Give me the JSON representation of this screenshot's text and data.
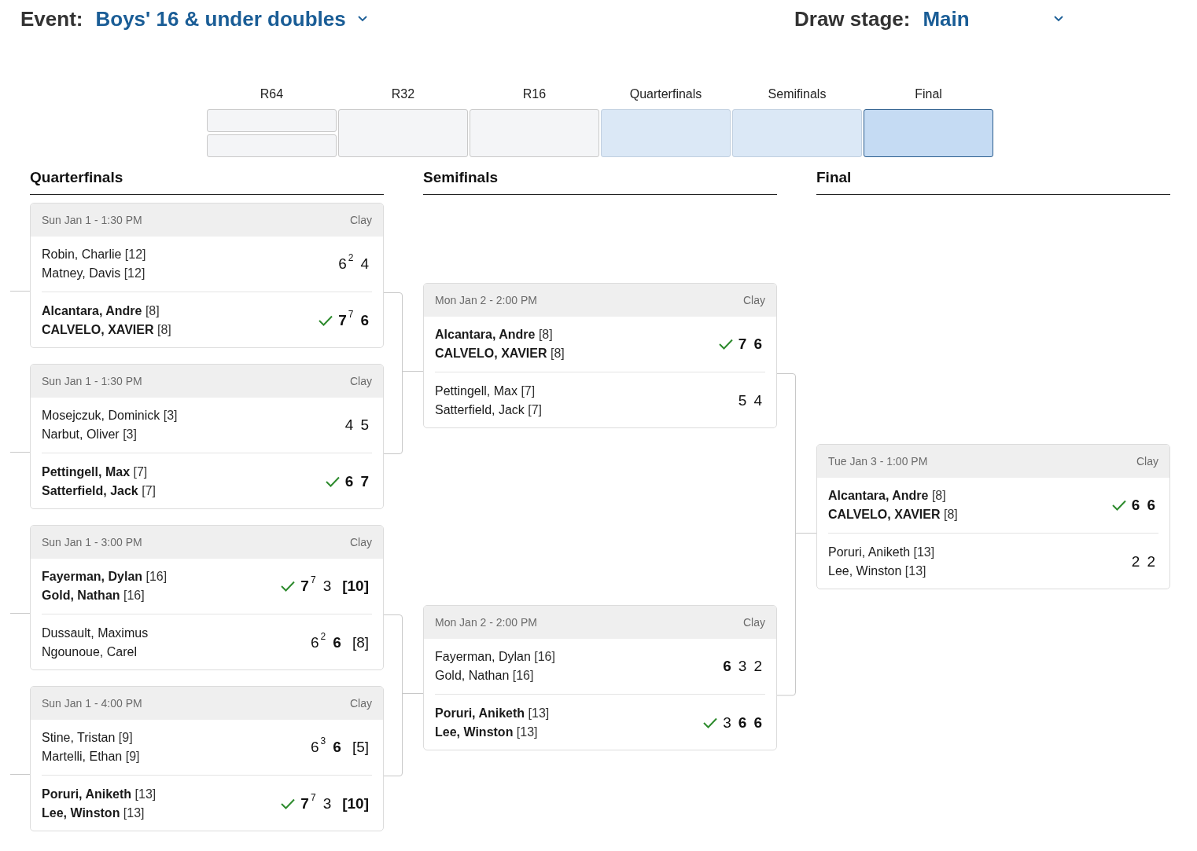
{
  "header": {
    "event": {
      "label": "Event:",
      "value": "Boys' 16 & under doubles"
    },
    "draw_stage": {
      "label": "Draw stage:",
      "value": "Main"
    }
  },
  "round_nav": [
    {
      "label": "R64",
      "kind": "split",
      "in_view": false,
      "selected": false
    },
    {
      "label": "R32",
      "kind": "single",
      "in_view": false,
      "selected": false
    },
    {
      "label": "R16",
      "kind": "single",
      "in_view": false,
      "selected": false
    },
    {
      "label": "Quarterfinals",
      "kind": "single",
      "in_view": true,
      "selected": false
    },
    {
      "label": "Semifinals",
      "kind": "single",
      "in_view": true,
      "selected": false
    },
    {
      "label": "Final",
      "kind": "single",
      "in_view": true,
      "selected": true
    }
  ],
  "columns": [
    {
      "title": "Quarterfinals",
      "matches": [
        {
          "date": "Sun Jan 1 - 1:30 PM",
          "surface": "Clay",
          "teams": [
            {
              "winner": false,
              "players": [
                {
                  "name": "Robin, Charlie",
                  "seed": "[12]"
                },
                {
                  "name": "Matney, Davis",
                  "seed": "[12]"
                }
              ],
              "scores": [
                {
                  "games": "6",
                  "tiebreak": "2",
                  "won": false
                },
                {
                  "games": "4",
                  "won": false
                }
              ]
            },
            {
              "winner": true,
              "players": [
                {
                  "name": "Alcantara, Andre",
                  "seed": "[8]"
                },
                {
                  "name": "CALVELO, XAVIER",
                  "seed": "[8]"
                }
              ],
              "scores": [
                {
                  "games": "7",
                  "tiebreak": "7",
                  "won": true
                },
                {
                  "games": "6",
                  "won": true
                }
              ]
            }
          ]
        },
        {
          "date": "Sun Jan 1 - 1:30 PM",
          "surface": "Clay",
          "teams": [
            {
              "winner": false,
              "players": [
                {
                  "name": "Mosejczuk, Dominick",
                  "seed": "[3]"
                },
                {
                  "name": "Narbut, Oliver",
                  "seed": "[3]"
                }
              ],
              "scores": [
                {
                  "games": "4",
                  "won": false
                },
                {
                  "games": "5",
                  "won": false
                }
              ]
            },
            {
              "winner": true,
              "players": [
                {
                  "name": "Pettingell, Max",
                  "seed": "[7]"
                },
                {
                  "name": "Satterfield, Jack",
                  "seed": "[7]"
                }
              ],
              "scores": [
                {
                  "games": "6",
                  "won": true
                },
                {
                  "games": "7",
                  "won": true
                }
              ]
            }
          ]
        },
        {
          "date": "Sun Jan 1 - 3:00 PM",
          "surface": "Clay",
          "teams": [
            {
              "winner": true,
              "players": [
                {
                  "name": "Fayerman, Dylan",
                  "seed": "[16]"
                },
                {
                  "name": "Gold, Nathan",
                  "seed": "[16]"
                }
              ],
              "scores": [
                {
                  "games": "7",
                  "tiebreak": "7",
                  "won": true
                },
                {
                  "games": "3",
                  "won": false
                },
                {
                  "games": "[10]",
                  "won": true
                }
              ]
            },
            {
              "winner": false,
              "players": [
                {
                  "name": "Dussault, Maximus"
                },
                {
                  "name": "Ngounoue, Carel"
                }
              ],
              "scores": [
                {
                  "games": "6",
                  "tiebreak": "2",
                  "won": false
                },
                {
                  "games": "6",
                  "won": true
                },
                {
                  "games": "[8]",
                  "won": false
                }
              ]
            }
          ]
        },
        {
          "date": "Sun Jan 1 - 4:00 PM",
          "surface": "Clay",
          "teams": [
            {
              "winner": false,
              "players": [
                {
                  "name": "Stine, Tristan",
                  "seed": "[9]"
                },
                {
                  "name": "Martelli, Ethan",
                  "seed": "[9]"
                }
              ],
              "scores": [
                {
                  "games": "6",
                  "tiebreak": "3",
                  "won": false
                },
                {
                  "games": "6",
                  "won": true
                },
                {
                  "games": "[5]",
                  "won": false
                }
              ]
            },
            {
              "winner": true,
              "players": [
                {
                  "name": "Poruri, Aniketh",
                  "seed": "[13]"
                },
                {
                  "name": "Lee, Winston",
                  "seed": "[13]"
                }
              ],
              "scores": [
                {
                  "games": "7",
                  "tiebreak": "7",
                  "won": true
                },
                {
                  "games": "3",
                  "won": false
                },
                {
                  "games": "[10]",
                  "won": true
                }
              ]
            }
          ]
        }
      ]
    },
    {
      "title": "Semifinals",
      "matches": [
        {
          "date": "Mon Jan 2 - 2:00 PM",
          "surface": "Clay",
          "teams": [
            {
              "winner": true,
              "players": [
                {
                  "name": "Alcantara, Andre",
                  "seed": "[8]"
                },
                {
                  "name": "CALVELO, XAVIER",
                  "seed": "[8]"
                }
              ],
              "scores": [
                {
                  "games": "7",
                  "won": true
                },
                {
                  "games": "6",
                  "won": true
                }
              ]
            },
            {
              "winner": false,
              "players": [
                {
                  "name": "Pettingell, Max",
                  "seed": "[7]"
                },
                {
                  "name": "Satterfield, Jack",
                  "seed": "[7]"
                }
              ],
              "scores": [
                {
                  "games": "5",
                  "won": false
                },
                {
                  "games": "4",
                  "won": false
                }
              ]
            }
          ]
        },
        {
          "date": "Mon Jan 2 - 2:00 PM",
          "surface": "Clay",
          "teams": [
            {
              "winner": false,
              "players": [
                {
                  "name": "Fayerman, Dylan",
                  "seed": "[16]"
                },
                {
                  "name": "Gold, Nathan",
                  "seed": "[16]"
                }
              ],
              "scores": [
                {
                  "games": "6",
                  "won": true
                },
                {
                  "games": "3",
                  "won": false
                },
                {
                  "games": "2",
                  "won": false
                }
              ]
            },
            {
              "winner": true,
              "players": [
                {
                  "name": "Poruri, Aniketh",
                  "seed": "[13]"
                },
                {
                  "name": "Lee, Winston",
                  "seed": "[13]"
                }
              ],
              "scores": [
                {
                  "games": "3",
                  "won": false
                },
                {
                  "games": "6",
                  "won": true
                },
                {
                  "games": "6",
                  "won": true
                }
              ]
            }
          ]
        }
      ]
    },
    {
      "title": "Final",
      "matches": [
        {
          "date": "Tue Jan 3 - 1:00 PM",
          "surface": "Clay",
          "teams": [
            {
              "winner": true,
              "players": [
                {
                  "name": "Alcantara, Andre",
                  "seed": "[8]"
                },
                {
                  "name": "CALVELO, XAVIER",
                  "seed": "[8]"
                }
              ],
              "scores": [
                {
                  "games": "6",
                  "won": true
                },
                {
                  "games": "6",
                  "won": true
                }
              ]
            },
            {
              "winner": false,
              "players": [
                {
                  "name": "Poruri, Aniketh",
                  "seed": "[13]"
                },
                {
                  "name": "Lee, Winston",
                  "seed": "[13]"
                }
              ],
              "scores": [
                {
                  "games": "2",
                  "won": false
                },
                {
                  "games": "2",
                  "won": false
                }
              ]
            }
          ]
        }
      ]
    }
  ]
}
